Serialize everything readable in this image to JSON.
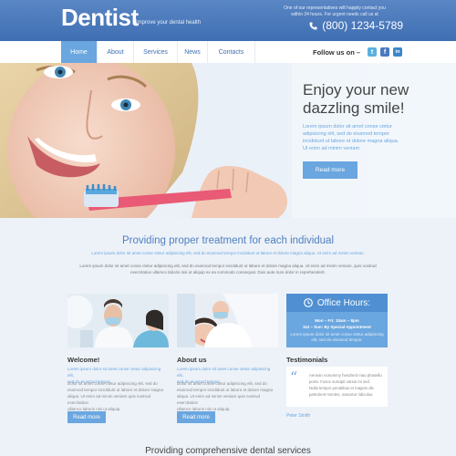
{
  "header": {
    "logo": "Dentist",
    "tagline": "Improve your dental health",
    "contact_line1": "One of our representatives will happily contact you",
    "contact_line2": "within 24 hours. For urgent needs call us at",
    "phone": "(800) 1234-5789",
    "phone_icon": "phone-icon"
  },
  "nav": {
    "items": [
      {
        "label": "Home",
        "active": true
      },
      {
        "label": "About"
      },
      {
        "label": "Services"
      },
      {
        "label": "News"
      },
      {
        "label": "Contacts"
      }
    ],
    "follow_label": "Follow us on –",
    "social": [
      {
        "icon": "twitter-icon",
        "glyph": "t",
        "color": "#5ab0de"
      },
      {
        "icon": "facebook-icon",
        "glyph": "f",
        "color": "#4a78c2"
      },
      {
        "icon": "linkedin-icon",
        "glyph": "in",
        "color": "#3a86c8"
      }
    ]
  },
  "hero": {
    "title_line1": "Enjoy your new",
    "title_line2": "dazzling smile!",
    "text_lines": [
      "Lorem ipsum dolor sit amet conse ctetur",
      "adipisicing elit, sed do eiusmod tempor",
      "incididunt ut labore et dolore magna aliqua.",
      "Ut enim ad minim veniam"
    ],
    "button": "Read more"
  },
  "intro": {
    "title": "Providing proper treatment for each individual",
    "subtitle": "Lorem ipsum dolor sit amet conse ctetur adipisicing elit, sed do eiusmod tempor incididunt ut labore et dolore magna aliqua. Ut enim ad minim veniam.",
    "body_line1": "Lorem ipsum dolor sit amet conse ctetur adipisicing elit, sed do eiusmod tempor incididunt ut labore et dolore magna aliqua. Ut enim ad minim veniam, quis nostrud",
    "body_line2": "exercitation ullamco laboris nisi ut aliquip ex ea commodo consequat. Duis aute irure dolor in reprehenderit."
  },
  "welcome": {
    "title": "Welcome!",
    "blue_lines": [
      "Lorem ipsum dolor sit amet conse ctetur adipisicing elit,",
      "sed do eiusmod tempor"
    ],
    "text_lines": [
      "Dolor sit amet conse ctetur adipisicing elit, sed do",
      "eiusmod tempor incididunt ut labore et dolore magna",
      "aliqua. Ut enim ad minim veniam quis nostrud exercitation",
      "ullamco laboris nisi ut aliquip."
    ],
    "button": "Read more"
  },
  "about": {
    "title": "About us",
    "blue_lines": [
      "Lorem ipsum dolor sit amet conse ctetur adipisicing elit,",
      "sed do eiusmod tempor"
    ],
    "text_lines": [
      "Dolor sit amet conse ctetur adipisicing elit, sed do",
      "eiusmod tempor incididunt ut labore et dolore magna",
      "aliqua. Ut enim ad minim veniam quis nostrud exercitation",
      "ullamco laboris nisi ut aliquip."
    ],
    "button": "Read more"
  },
  "office": {
    "title": "Office Hours:",
    "icon": "clock-icon",
    "line1": "Mon – Fri: 10am – 8pm",
    "line2": "Sat – Sun: By Special Appointment",
    "line3": "Lorem ipsum dolor sit amet conse ctetur adipisicing",
    "line4": "elit, sed do eiusmod tempor."
  },
  "testimonials": {
    "title": "Testimonials",
    "quote_lines": [
      "Aenean nonummy hendrerit mau phasellu",
      "porta. Fusce suscipit varius mi sed.",
      "Nulla tempor penatibus et magnis dis",
      "parturient montes, nascetur ridiculus."
    ],
    "author": "Peter Smith"
  },
  "bottom": {
    "title": "Providing comprehensive dental services"
  },
  "colors": {
    "accent": "#6aa6df",
    "header": "#3f6fb3"
  }
}
